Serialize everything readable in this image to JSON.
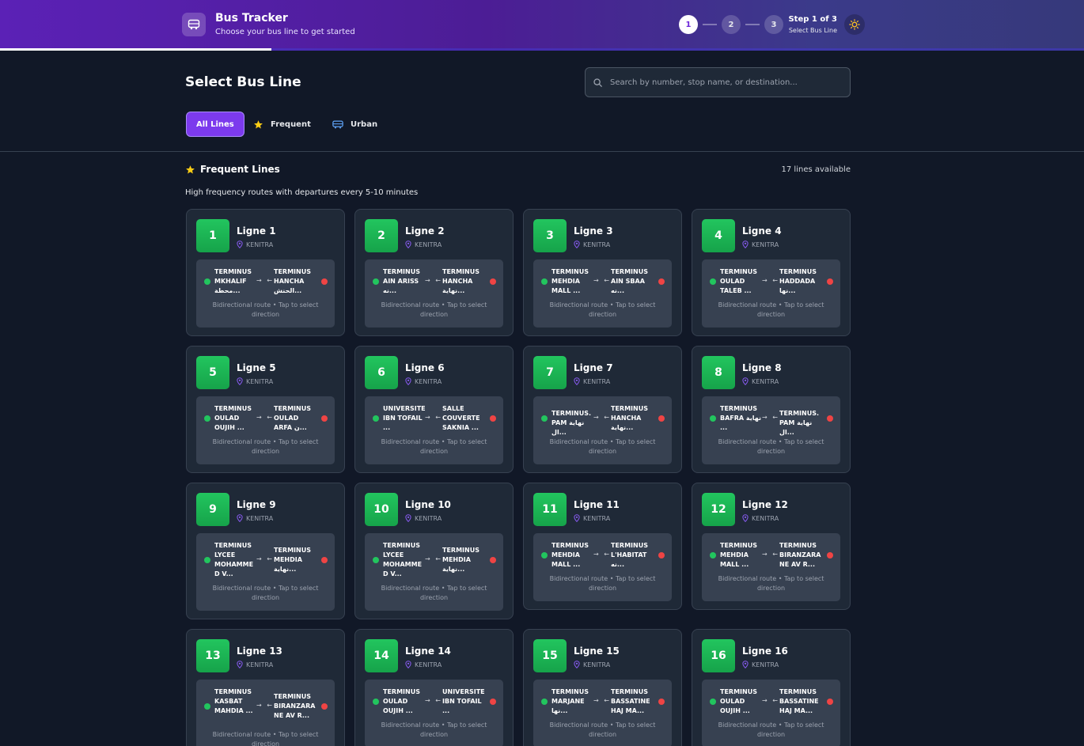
{
  "header": {
    "title": "Bus Tracker",
    "subtitle": "Choose your bus line to get started",
    "steps": [
      "1",
      "2",
      "3"
    ],
    "step_label": "Step 1 of 3",
    "step_sub": "Select Bus Line",
    "progress": 0.25
  },
  "page": {
    "title": "Select Bus Line",
    "search_placeholder": "Search by number, stop name, or destination..."
  },
  "filters": [
    {
      "label": "All Lines",
      "active": true
    },
    {
      "label": "Frequent",
      "icon": "star-icon"
    },
    {
      "label": "Urban",
      "icon": "bus-icon"
    }
  ],
  "section": {
    "title": "Frequent Lines",
    "count": "17 lines available",
    "description": "High frequency routes with departures every 5-10 minutes"
  },
  "route_hint": "Bidirectional route • Tap to select direction",
  "colors": {
    "accent": "#7c3aed",
    "badge": "#22c55e",
    "start": "#22c55e",
    "end": "#ef4444"
  },
  "lines": [
    {
      "number": "1",
      "name": "Ligne 1",
      "city": "KENITRA",
      "from": "TERMINUS MKHALIF محطة...",
      "to": "TERMINUS HANCHA الحنش..."
    },
    {
      "number": "2",
      "name": "Ligne 2",
      "city": "KENITRA",
      "from": "TERMINUS AIN ARISS نه...",
      "to": "TERMINUS HANCHA نهاية..."
    },
    {
      "number": "3",
      "name": "Ligne 3",
      "city": "KENITRA",
      "from": "TERMINUS MEHDIA MALL ...",
      "to": "TERMINUS AIN SBAA نه..."
    },
    {
      "number": "4",
      "name": "Ligne 4",
      "city": "KENITRA",
      "from": "TERMINUS OULAD TALEB ...",
      "to": "TERMINUS HADDADA نها..."
    },
    {
      "number": "5",
      "name": "Ligne 5",
      "city": "KENITRA",
      "from": "TERMINUS OULAD OUJIH ...",
      "to": "TERMINUS OULAD ARFA ن..."
    },
    {
      "number": "6",
      "name": "Ligne 6",
      "city": "KENITRA",
      "from": "UNIVERSITE IBN TOFAIL ...",
      "to": "SALLE COUVERTE SAKNIA ..."
    },
    {
      "number": "7",
      "name": "Ligne 7",
      "city": "KENITRA",
      "from": "TERMINUS.PAM نهاية ال...",
      "to": "TERMINUS HANCHA نهاية..."
    },
    {
      "number": "8",
      "name": "Ligne 8",
      "city": "KENITRA",
      "from": "TERMINUS BAFRA نهاية ...",
      "to": "TERMINUS.PAM نهاية ال..."
    },
    {
      "number": "9",
      "name": "Ligne 9",
      "city": "KENITRA",
      "from": "TERMINUS LYCEE MOHAMMED V...",
      "to": "TERMINUS MEHDIA نهاية..."
    },
    {
      "number": "10",
      "name": "Ligne 10",
      "city": "KENITRA",
      "from": "TERMINUS LYCEE MOHAMMED V...",
      "to": "TERMINUS MEHDIA نهاية..."
    },
    {
      "number": "11",
      "name": "Ligne 11",
      "city": "KENITRA",
      "from": "TERMINUS MEHDIA MALL ...",
      "to": "TERMINUS L'HABITAT نه..."
    },
    {
      "number": "12",
      "name": "Ligne 12",
      "city": "KENITRA",
      "from": "TERMINUS MEHDIA MALL ...",
      "to": "TERMINUS BIRANZARANE AV R..."
    },
    {
      "number": "13",
      "name": "Ligne 13",
      "city": "KENITRA",
      "from": "TERMINUS KASBAT MAHDIA ...",
      "to": "TERMINUS BIRANZARANE AV R..."
    },
    {
      "number": "14",
      "name": "Ligne 14",
      "city": "KENITRA",
      "from": "TERMINUS OULAD OUJIH ...",
      "to": "UNIVERSITE IBN TOFAIL ..."
    },
    {
      "number": "15",
      "name": "Ligne 15",
      "city": "KENITRA",
      "from": "TERMINUS MARJANE نها...",
      "to": "TERMINUS BASSATINE HAJ MA..."
    },
    {
      "number": "16",
      "name": "Ligne 16",
      "city": "KENITRA",
      "from": "TERMINUS OULAD OUJIH ...",
      "to": "TERMINUS BASSATINE HAJ MA..."
    }
  ]
}
